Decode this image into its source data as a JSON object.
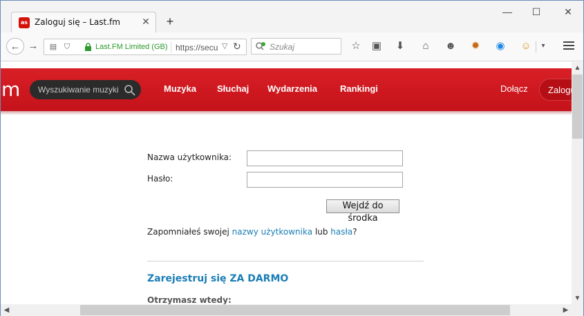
{
  "browser": {
    "tab": {
      "title": "Zaloguj się – Last.fm",
      "favicon": "lastfm-icon"
    },
    "window_controls": {
      "minimize": "—",
      "maximize": "☐",
      "close": "✕"
    },
    "new_tab": "+",
    "urlbar": {
      "identity": "Last.FM Limited (GB)",
      "url": "https://secure.last.fm",
      "identity_color": "#2a9a2a"
    },
    "searchbar": {
      "placeholder": "Szukaj"
    }
  },
  "site": {
    "brand_color": "#d51007",
    "logo_fragment": "m",
    "search_placeholder": "Wyszukiwanie muzyki",
    "nav": [
      "Muzyka",
      "Słuchaj",
      "Wydarzenia",
      "Rankingi"
    ],
    "join": "Dołącz",
    "login": "Zaloguj"
  },
  "form": {
    "username_label": "Nazwa użytkownika:",
    "username_value": "",
    "password_label": "Hasło:",
    "password_value": "",
    "submit": "Wejdź do środka",
    "forgot_prefix": "Zapomniałeś swojej ",
    "forgot_username": "nazwy użytkownika",
    "forgot_or": " lub ",
    "forgot_password": "hasła",
    "forgot_suffix": "?",
    "register_heading": "Zarejestruj się ZA DARMO",
    "benefits_heading": "Otrzymasz wtedy:"
  }
}
